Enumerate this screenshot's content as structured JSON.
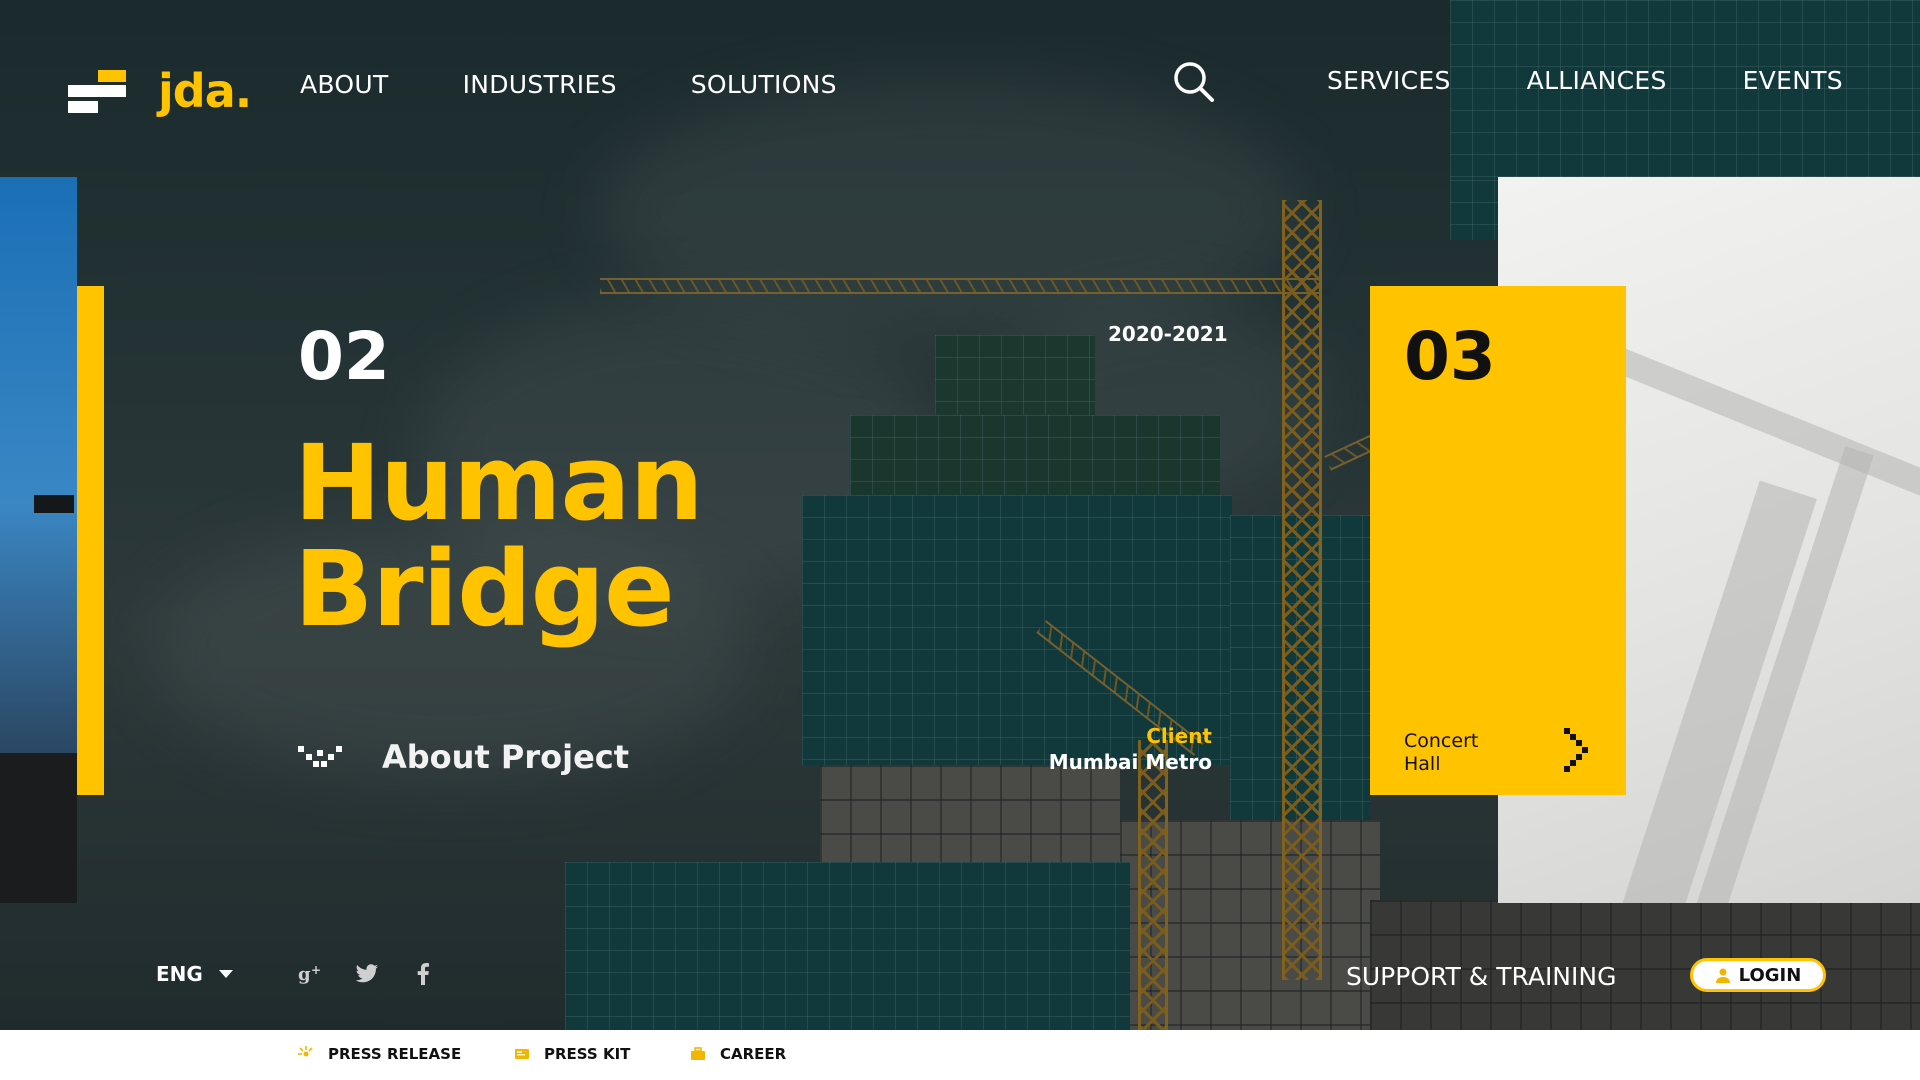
{
  "brand": {
    "name": "jda.",
    "accent_color": "#ffc300"
  },
  "nav": {
    "left": [
      "ABOUT",
      "INDUSTRIES",
      "SOLUTIONS"
    ],
    "right": [
      "SERVICES",
      "ALLIANCES",
      "EVENTS"
    ],
    "search_icon": "search-icon"
  },
  "project": {
    "number": "02",
    "years": "2020-2021",
    "title_line1": "Human",
    "title_line2": "Bridge",
    "about_label": "About Project",
    "client_label": "Client",
    "client_name": "Mumbai Metro"
  },
  "next_project": {
    "number": "03",
    "name_line1": "Concert",
    "name_line2": "Hall"
  },
  "bottom_bar": {
    "language": "ENG",
    "social_icons": [
      "google-plus-icon",
      "twitter-icon",
      "facebook-icon"
    ],
    "support_label": "SUPPORT & TRAINING",
    "login_label": "LOGIN"
  },
  "footer": {
    "links": [
      {
        "label": "PRESS RELEASE",
        "icon": "press-release-icon"
      },
      {
        "label": "PRESS KIT",
        "icon": "press-kit-icon"
      },
      {
        "label": "CAREER",
        "icon": "career-icon"
      }
    ]
  }
}
